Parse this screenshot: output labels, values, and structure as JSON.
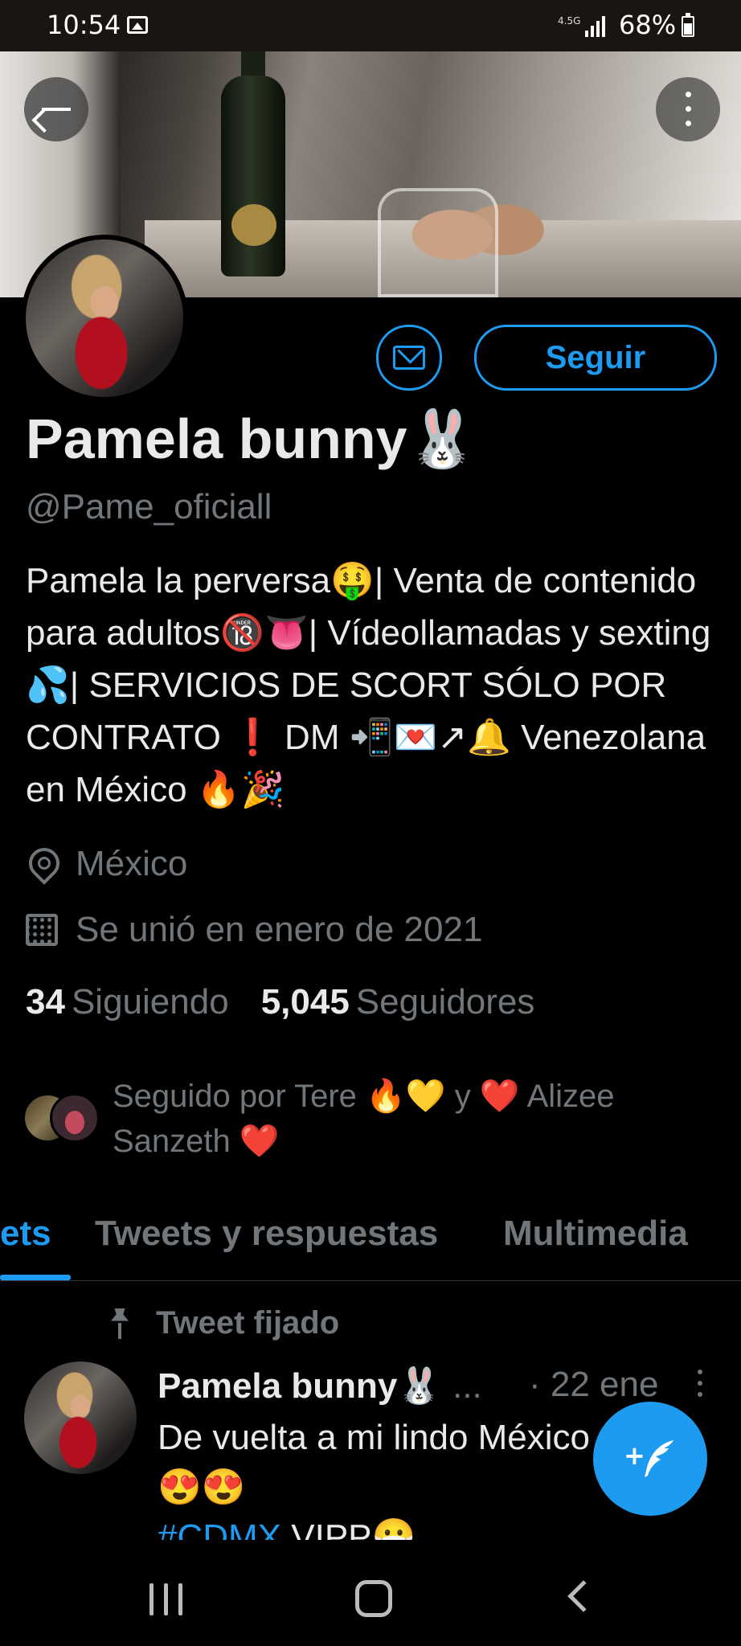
{
  "status_bar": {
    "time": "10:54",
    "network": "4.5G",
    "battery": "68%"
  },
  "icons": {
    "back": "arrow-left-icon",
    "more": "more-vertical-icon",
    "message": "mail-icon",
    "location": "location-pin-icon",
    "joined": "calendar-icon",
    "pinned": "pushpin-icon",
    "compose": "compose-tweet-icon"
  },
  "profile": {
    "name": "Pamela bunny🐰",
    "handle": "@Pame_oficiall",
    "follow_label": "Seguir",
    "bio": "Pamela la perversa🤑| Venta de contenido para adultos🔞👅| Vídeollamadas y sexting 💦| SERVICIOS DE SCORT SÓLO POR CONTRATO ❗ DM 📲💌↗🔔 Venezolana en México 🔥🎉",
    "location": "México",
    "joined": "Se unió en enero de 2021",
    "following_count": "34",
    "following_label": "Siguiendo",
    "followers_count": "5,045",
    "followers_label": "Seguidores",
    "followed_by": "Seguido por Tere 🔥💛 y ❤️ Alizee Sanzeth ❤️"
  },
  "tabs": [
    {
      "label": "Tweets",
      "visible_label": "ets",
      "active": true
    },
    {
      "label": "Tweets y respuestas",
      "active": false
    },
    {
      "label": "Multimedia",
      "active": false
    }
  ],
  "pinned_tweet": {
    "pinned_label": "Tweet fijado",
    "author": "Pamela bunny🐰",
    "ellipsis": "...",
    "date": "· 22 ene",
    "text": "De vuelta a mi lindo México",
    "text_emojis": "😍😍",
    "hashtag": "#CDMX",
    "text_tail": " VIPP😷"
  },
  "colors": {
    "accent": "#1d9bf0",
    "background": "#000000",
    "secondary_text": "#71767b"
  }
}
